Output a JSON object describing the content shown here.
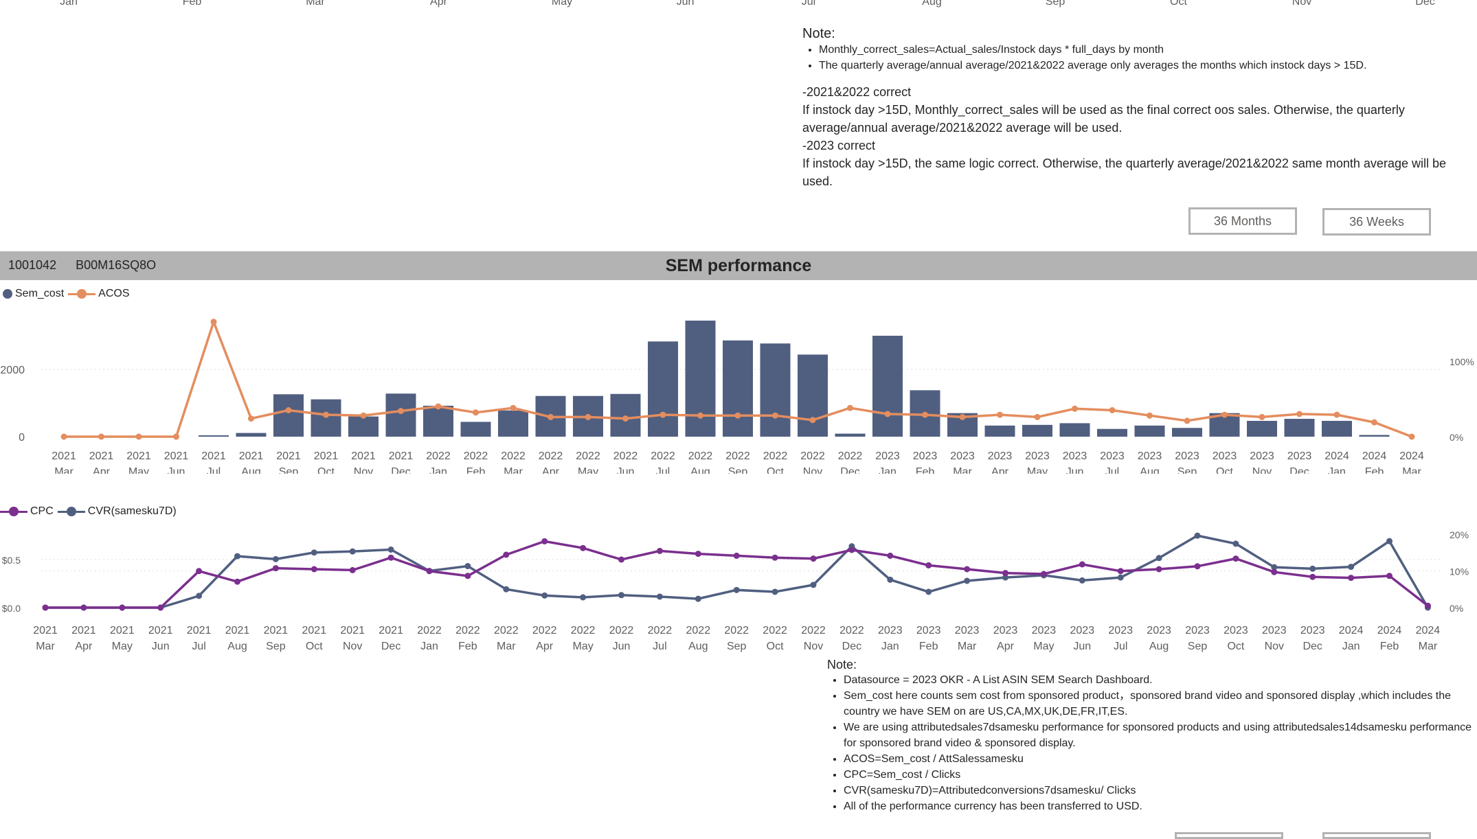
{
  "top_axis_months": [
    "Jan",
    "Feb",
    "Mar",
    "Apr",
    "May",
    "Jun",
    "Jul",
    "Aug",
    "Sep",
    "Oct",
    "Nov",
    "Dec"
  ],
  "note1": {
    "title": "Note:",
    "bullets": [
      "Monthly_correct_sales=Actual_sales/Instock days * full_days by month",
      "The quarterly average/annual average/2021&2022 average only averages the months which instock days > 15D."
    ],
    "body": [
      "-2021&2022 correct",
      "If instock day >15D, Monthly_correct_sales will be used as the final correct oos sales. Otherwise, the quarterly average/annual average/2021&2022 average will be used.",
      "-2023 correct",
      "If instock day >15D, the same logic correct. Otherwise, the quarterly average/2021&2022 same month average will be used."
    ]
  },
  "buttons": {
    "months": "36 Months",
    "weeks": "36 Weeks"
  },
  "banner": {
    "id1": "1001042",
    "id2": "B00M16SQ8O",
    "title": "SEM performance"
  },
  "legend1": {
    "sem_cost": "Sem_cost",
    "acos": "ACOS"
  },
  "legend2": {
    "cpc": "CPC",
    "cvr": "CVR(samesku7D)"
  },
  "colors": {
    "bar": "#505f80",
    "acos": "#e48d5e",
    "cpc": "#7b2f8e",
    "cvr": "#505f80"
  },
  "chart_data": [
    {
      "type": "bar",
      "title": "",
      "categories": [
        "2021 Mar",
        "2021 Apr",
        "2021 May",
        "2021 Jun",
        "2021 Jul",
        "2021 Aug",
        "2021 Sep",
        "2021 Oct",
        "2021 Nov",
        "2021 Dec",
        "2022 Jan",
        "2022 Feb",
        "2022 Mar",
        "2022 Apr",
        "2022 May",
        "2022 Jun",
        "2022 Jul",
        "2022 Aug",
        "2022 Sep",
        "2022 Oct",
        "2022 Nov",
        "2022 Dec",
        "2023 Jan",
        "2023 Feb",
        "2023 Mar",
        "2023 Apr",
        "2023 May",
        "2023 Jun",
        "2023 Jul",
        "2023 Aug",
        "2023 Sep",
        "2023 Oct",
        "2023 Nov",
        "2023 Dec",
        "2024 Jan",
        "2024 Feb",
        "2024 Mar"
      ],
      "series": [
        {
          "name": "Sem_cost",
          "axis": "left",
          "values": [
            0,
            0,
            0,
            0,
            40,
            110,
            1260,
            1110,
            600,
            1280,
            920,
            440,
            780,
            1210,
            1210,
            1270,
            2830,
            3450,
            2860,
            2770,
            2440,
            90,
            3000,
            1380,
            700,
            330,
            350,
            400,
            230,
            330,
            260,
            700,
            470,
            530,
            470,
            50,
            0
          ]
        },
        {
          "name": "ACOS",
          "axis": "right",
          "values": [
            0,
            0,
            0,
            0,
            152,
            24,
            35,
            29,
            28,
            34,
            40,
            32,
            38,
            26,
            26,
            24,
            29,
            28,
            28,
            28,
            22,
            38,
            30,
            29,
            26,
            29,
            26,
            37,
            35,
            28,
            21,
            29,
            26,
            30,
            29,
            19,
            0
          ]
        }
      ],
      "yticks_left": [
        "0",
        "2000"
      ],
      "ylim_left": [
        0,
        3500
      ],
      "yticks_right": [
        "0%",
        "100%"
      ],
      "ylim_right": [
        0,
        175
      ],
      "legend": "top-left",
      "grid": true
    },
    {
      "type": "line",
      "title": "",
      "categories": [
        "2021 Mar",
        "2021 Apr",
        "2021 May",
        "2021 Jun",
        "2021 Jul",
        "2021 Aug",
        "2021 Sep",
        "2021 Oct",
        "2021 Nov",
        "2021 Dec",
        "2022 Jan",
        "2022 Feb",
        "2022 Mar",
        "2022 Apr",
        "2022 May",
        "2022 Jun",
        "2022 Jul",
        "2022 Aug",
        "2022 Sep",
        "2022 Oct",
        "2022 Nov",
        "2022 Dec",
        "2023 Jan",
        "2023 Feb",
        "2023 Mar",
        "2023 Apr",
        "2023 May",
        "2023 Jun",
        "2023 Jul",
        "2023 Aug",
        "2023 Sep",
        "2023 Oct",
        "2023 Nov",
        "2023 Dec",
        "2024 Jan",
        "2024 Feb",
        "2024 Mar"
      ],
      "series": [
        {
          "name": "CPC",
          "axis": "left",
          "values": [
            0,
            0,
            0,
            0,
            0.38,
            0.27,
            0.41,
            0.4,
            0.39,
            0.52,
            0.38,
            0.33,
            0.55,
            0.69,
            0.62,
            0.5,
            0.59,
            0.56,
            0.54,
            0.52,
            0.51,
            0.6,
            0.54,
            0.44,
            0.4,
            0.36,
            0.35,
            0.45,
            0.38,
            0.4,
            0.43,
            0.51,
            0.37,
            0.32,
            0.31,
            0.33,
            0.02
          ]
        },
        {
          "name": "CVR(samesku7D)",
          "axis": "right",
          "values": [
            0,
            0,
            0,
            0,
            3.2,
            14,
            13.2,
            15,
            15.3,
            15.8,
            10,
            11.3,
            5,
            3.3,
            2.8,
            3.4,
            3,
            2.4,
            4.8,
            4.3,
            6.2,
            16.7,
            7.6,
            4.3,
            7.3,
            8.2,
            8.8,
            7.4,
            8.2,
            13.5,
            19.6,
            17.4,
            11,
            10.6,
            11.1,
            18.1,
            0
          ]
        }
      ],
      "yticks_left": [
        "$0.0",
        "$0.5"
      ],
      "ylim_left": [
        0,
        1.0
      ],
      "yticks_right": [
        "0%",
        "10%",
        "20%"
      ],
      "ylim_right": [
        0,
        20
      ],
      "legend": "top-left",
      "grid": true
    }
  ],
  "note2": {
    "title": "Note:",
    "bullets": [
      "Datasource = 2023 OKR - A List ASIN SEM Search Dashboard.",
      "Sem_cost here counts sem cost from sponsored product，sponsored brand video and  sponsored display ,which includes the country we have SEM on are US,CA,MX,UK,DE,FR,IT,ES.",
      "We are using attributedsales7dsamesku performance for sponsored products and using attributedsales14dsamesku performance for sponsored brand video & sponsored display.",
      "ACOS=Sem_cost / AttSalessamesku",
      "CPC=Sem_cost / Clicks",
      "CVR(samesku7D)=Attributedconversions7dsamesku/ Clicks",
      "All of the performance currency has been transferred to USD."
    ]
  }
}
